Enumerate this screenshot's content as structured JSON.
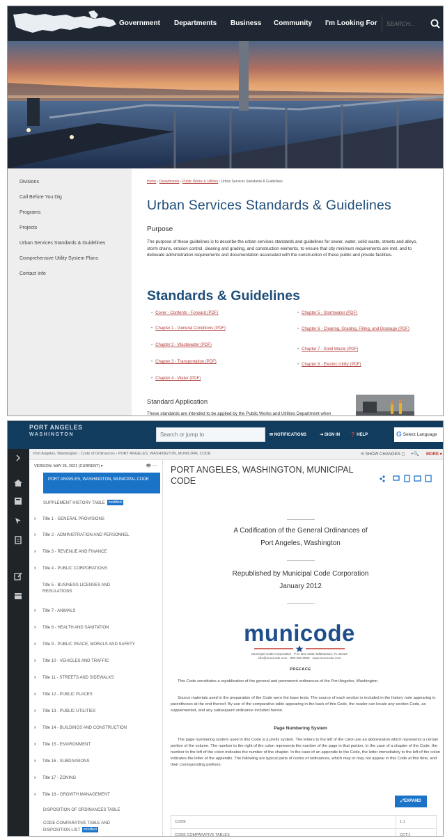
{
  "site": {
    "nav": [
      "Government",
      "Departments",
      "Business",
      "Community",
      "I'm Looking For"
    ],
    "search_placeholder": "SEARCH..."
  },
  "sidebar": {
    "items": [
      "Divisions",
      "Call Before You Dig",
      "Programs",
      "Projects",
      "Urban Services Standards & Guidelines",
      "Comprehensive Utility System Plans",
      "Contact Info"
    ]
  },
  "content": {
    "breadcrumb": [
      "Home",
      "Departments",
      "Public Works & Utilities",
      "Urban Services Standards & Guidelines"
    ],
    "title": "Urban Services Standards & Guidelines",
    "purpose_heading": "Purpose",
    "purpose_text": "The purpose of these guidelines is to describe the urban services standards and guidelines for sewer, water, solid waste, streets and alleys, storm drains, erosion control, clearing and grading, and construction elements, to ensure that city minimum requirements are met, and to delineate administration requirements and documentation associated with the construction of these public and private facilities.",
    "standards_heading": "Standards & Guidelines",
    "docs_left": [
      "Cover - Contents - Forward (PDF)",
      "Chapter 1 - General Conditions (PDF)",
      "Chapter 2 - Wastewater (PDF)",
      "Chapter 3 - Transportation (PDF)",
      "Chapter 4 - Water (PDF)"
    ],
    "docs_right": [
      "Chapter 5 - Stormwater (PDF)",
      "Chapter 6 - Clearing, Grading, Filling, and Drainage (PDF)",
      "Chapter 7 - Solid Waste (PDF)",
      "Chapter 8 - Electric Utility (PDF)"
    ],
    "app_heading": "Standard Application",
    "app_text": "These standards are intended to be applied by the Public Works and Utilities Department when reviewing developments for compliance with the requirements of the"
  },
  "municode": {
    "logo_line1": "PORT ANGELES",
    "logo_line2": "WASHINGTON",
    "search_placeholder": "Search or jump to",
    "notifications": "NOTIFICATIONS",
    "sign_in": "SIGN IN",
    "help": "HELP",
    "language": "Select Language",
    "breadcrumb": "Port Angeles, Washington - Code of Ordinances › PORT ANGELES, WASHINGTON, MUNICIPAL CODE",
    "show_changes": "SHOW CHANGES",
    "more": "MORE",
    "version": "VERSION: MAY 25, 2021 (CURRENT)",
    "toc_active": "PORT ANGELES, WASHINGTON, MUNICIPAL CODE",
    "toc_supplement": "SUPPLEMENT HISTORY TABLE",
    "badge": "modified",
    "toc_titles": [
      "Title 1 - GENERAL PROVISIONS",
      "Title 2 - ADMINISTRATION AND PERSONNEL",
      "Title 3 - REVENUE AND FINANCE",
      "Title 4 - PUBLIC CORPORATIONS",
      "Title 5 - BUSINESS LICENSES AND REGULATIONS",
      "Title 7 - ANIMALS",
      "Title 8 - HEALTH AND SANITATION",
      "Title 9 - PUBLIC PEACE, MORALS AND SAFETY",
      "Title 10 - VEHICLES AND TRAFFIC",
      "Title 11 - STREETS AND SIDEWALKS",
      "Title 12 - PUBLIC PLACES",
      "Title 13 - PUBLIC UTILITIES",
      "Title 14 - BUILDINGS AND CONSTRUCTION",
      "Title 15 - ENVIRONMENT",
      "Title 16 - SUBDIVISIONS",
      "Title 17 - ZONING",
      "Title 18 - GROWTH MANAGEMENT"
    ],
    "toc_disposition": "DISPOSITION OF ORDINANCES TABLE",
    "toc_comparative": "CODE COMPARATIVE TABLE AND DISPOSITION LIST",
    "doc_title": "PORT ANGELES, WASHINGTON, MUNICIPAL CODE",
    "codification_line1": "A Codification of the General Ordinances of",
    "codification_line2": "Port Angeles, Washington",
    "republished_line1": "Republished by Municipal Code Corporation",
    "republished_line2": "January 2012",
    "logo_word": "municode",
    "logo_address": "Municipal Code Corporation · P.O. Box 2235 Tallahassee, FL 32316",
    "logo_contact": "info@municode.com · 800.262.2633 · www.municode.com",
    "preface_heading": "PREFACE",
    "preface_p1": "This Code constitutes a republication of the general and permanent ordinances of the Port Angeles, Washington.",
    "preface_p2": "Source materials used in the preparation of the Code were the base texts. The source of each section is included in the history note appearing in parentheses at the end thereof. By use of the comparative table appearing in the back of this Code, the reader can locate any section Code, as supplemented, and any subsequent ordinance included herein.",
    "page_numbering_heading": "Page Numbering System",
    "page_numbering_text": "The page numbering system used in this Code is a prefix system. The letters to the left of the colon are an abbreviation which represents a certain portion of the volume. The number to the right of the colon represents the number of the page in that portion. In the case of a chapter of the Code, the number to the left of the colon indicates the number of the chapter. In the case of an appendix to the Code, the letter immediately to the left of the colon indicates the letter of the appendix. The following are typical parts of codes of ordinances, which may or may not appear in this Code at this time, and their corresponding prefixes:",
    "expand": "EXPAND",
    "table_rows": [
      [
        "CODE",
        "1:1"
      ],
      [
        "CODE COMPARATIVE TABLES",
        "CCT:1"
      ]
    ]
  }
}
